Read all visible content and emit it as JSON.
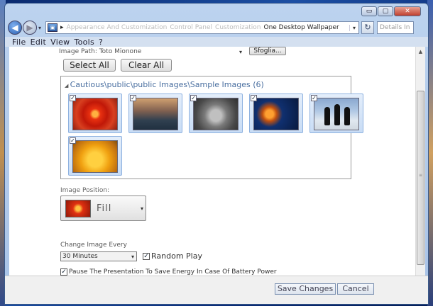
{
  "window": {
    "caption": {
      "minimize_symbol": "▭",
      "maximize_symbol": "▢",
      "close_symbol": "✕"
    }
  },
  "navbar": {
    "back_symbol": "◀",
    "forward_symbol": "▶",
    "dropdown_symbol": "▾",
    "address_parts": [
      "Appearance And Customization",
      "Control Panel",
      "Customization",
      "One Desktop Wallpaper"
    ],
    "search_placeholder": "Details In"
  },
  "menubar": {
    "items": [
      "File",
      "Edit",
      "View",
      "Tools",
      "?"
    ]
  },
  "content": {
    "image_path_label": "Image Path: Toto Mionone",
    "browse_label": "Sfoglia...",
    "select_all_label": "Select All",
    "clear_all_label": "Clear All",
    "gallery": {
      "header": "Cautious\\public\\public Images\\Sample Images (6)",
      "images": [
        {
          "name": "Chrysanthemum",
          "checked": true
        },
        {
          "name": "Lighthouse",
          "checked": true
        },
        {
          "name": "Koala",
          "checked": true
        },
        {
          "name": "Jellyfish",
          "checked": true
        },
        {
          "name": "Penguins",
          "checked": true
        },
        {
          "name": "Tulips",
          "checked": true
        }
      ]
    },
    "position_label": "Image Position:",
    "position_value": "Fill",
    "interval_label": "Change Image Every",
    "interval_value": "30 Minutes",
    "random_play_label": "Random Play",
    "random_play_checked": true,
    "battery_label": "Pause The Presentation To Save Energy In Case Of Battery Power",
    "battery_checked": true
  },
  "footer": {
    "save_label": "Save Changes",
    "cancel_label": "Cancel"
  }
}
